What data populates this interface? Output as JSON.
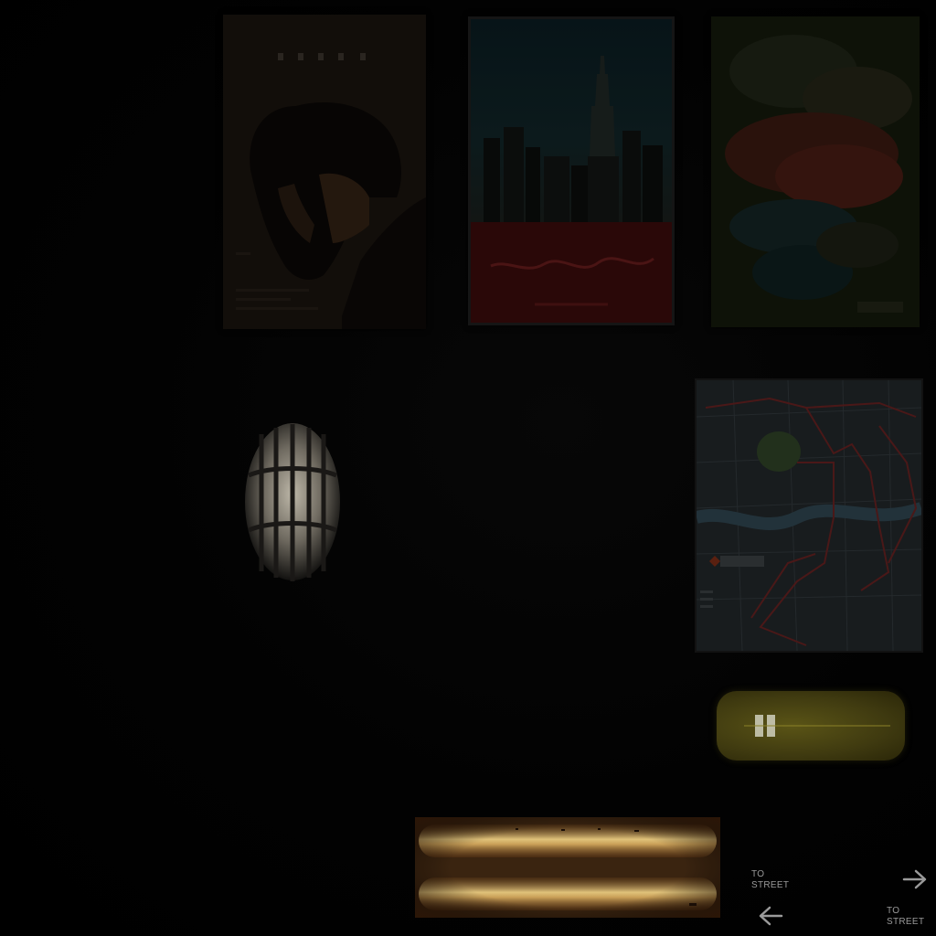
{
  "scene": {
    "background_color": "#000000"
  },
  "posters": [
    {
      "name": "portrait-poster",
      "accent": "#2a1a10"
    },
    {
      "name": "city-skyline-poster",
      "accent": "#3a0d0d"
    },
    {
      "name": "abstract-floral-poster",
      "accent": "#3a1410"
    }
  ],
  "wall_map": {
    "route_color": "#5a1a1a"
  },
  "lights": {
    "yellow_light_color": "#5a5416",
    "glow_vent_color": "#d8b868"
  },
  "navigation": {
    "forward": {
      "label": "TO\nSTREET",
      "icon": "arrow-right-icon"
    },
    "back": {
      "label": "TO\nSTREET",
      "icon": "arrow-left-icon"
    }
  }
}
